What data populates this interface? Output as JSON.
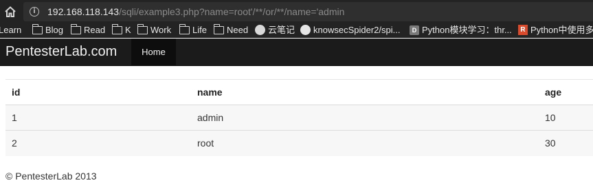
{
  "browser": {
    "url_host": "192.168.118.143",
    "url_path": "/sqli/example3.php?name=root'/**/or/**/name='admin",
    "bookmarks": [
      {
        "label": "Learn",
        "icon": "folder-icon"
      },
      {
        "label": "Blog",
        "icon": "folder-icon"
      },
      {
        "label": "Read",
        "icon": "folder-icon"
      },
      {
        "label": "K",
        "icon": "folder-icon"
      },
      {
        "label": "Work",
        "icon": "folder-icon"
      },
      {
        "label": "Life",
        "icon": "folder-icon"
      },
      {
        "label": "Need",
        "icon": "folder-icon"
      },
      {
        "label": "云笔记",
        "icon": "circle-icon"
      },
      {
        "label": "knowsecSpider2/spi...",
        "icon": "github-icon"
      },
      {
        "label": "Python模块学习：thr...",
        "icon": "doc-icon",
        "icon_text": "D"
      },
      {
        "label": "Python中使用多",
        "icon": "site-icon",
        "icon_text": "R"
      }
    ]
  },
  "navbar": {
    "brand": "PentesterLab.com",
    "home": "Home"
  },
  "table": {
    "headers": [
      "id",
      "name",
      "age"
    ],
    "rows": [
      [
        "1",
        "admin",
        "10"
      ],
      [
        "2",
        "root",
        "30"
      ]
    ]
  },
  "footer": "© PentesterLab 2013"
}
